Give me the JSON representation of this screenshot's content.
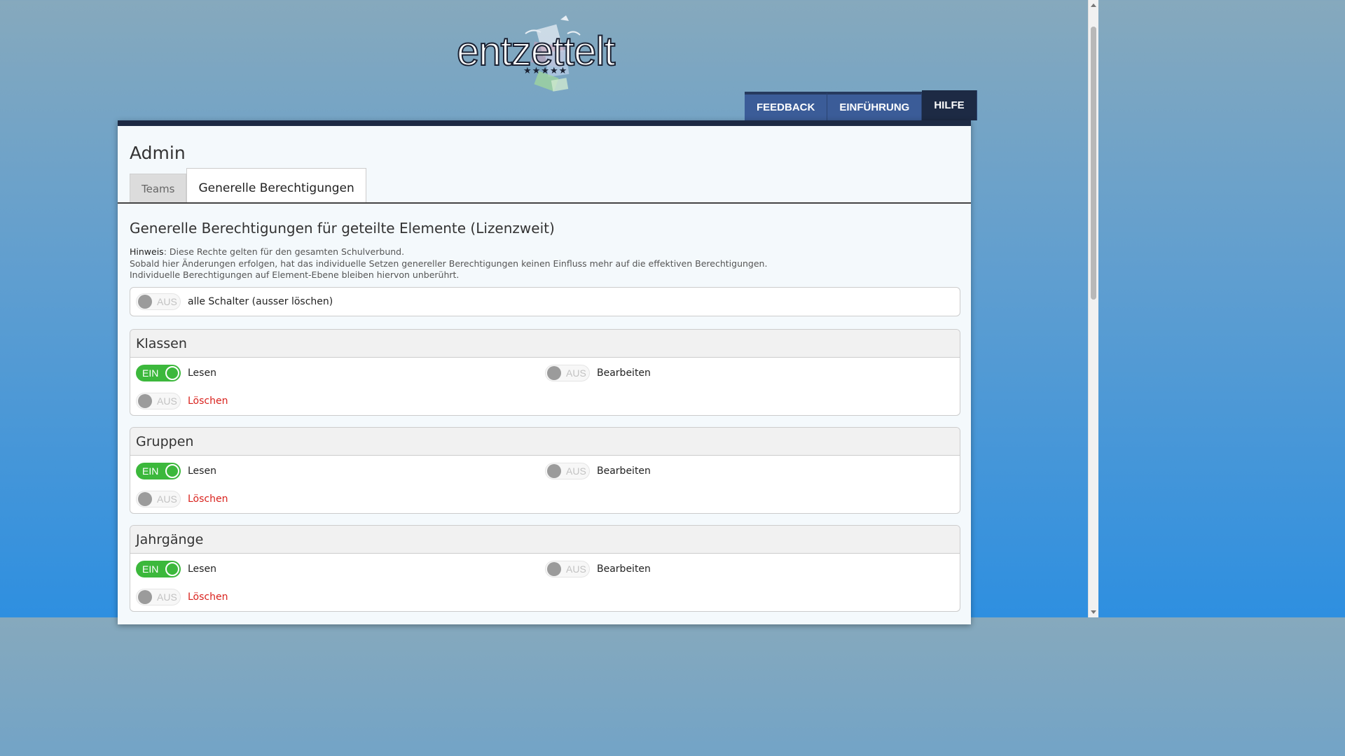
{
  "logo": {
    "text": "entzettelt",
    "stars": "★★★★★"
  },
  "nav": [
    {
      "label": "FEEDBACK",
      "active": false
    },
    {
      "label": "EINFÜHRUNG",
      "active": false
    },
    {
      "label": "HILFE",
      "active": true
    }
  ],
  "page": {
    "title": "Admin",
    "tabs": [
      {
        "label": "Teams",
        "active": false
      },
      {
        "label": "Generelle Berechtigungen",
        "active": true
      }
    ],
    "section_title": "Generelle Berechtigungen für geteilte Elemente (Lizenzweit)",
    "note": {
      "label": "Hinweis",
      "line1": ": Diese Rechte gelten für den gesamten Schulverbund.",
      "line2": "Sobald hier Änderungen erfolgen, hat das individuelle Setzen genereller Berechtigungen keinen Einfluss mehr auf die effektiven Berechtigungen.",
      "line3": "Individuelle Berechtigungen auf Element-Ebene bleiben hiervon unberührt."
    }
  },
  "toggle_text": {
    "on": "EIN",
    "off": "AUS"
  },
  "all_switch": {
    "label": "alle Schalter (ausser löschen)",
    "state": "off"
  },
  "panels": [
    {
      "title": "Klassen",
      "read": {
        "label": "Lesen",
        "state": "on"
      },
      "edit": {
        "label": "Bearbeiten",
        "state": "off"
      },
      "delete": {
        "label": "Löschen",
        "state": "off"
      }
    },
    {
      "title": "Gruppen",
      "read": {
        "label": "Lesen",
        "state": "on"
      },
      "edit": {
        "label": "Bearbeiten",
        "state": "off"
      },
      "delete": {
        "label": "Löschen",
        "state": "off"
      }
    },
    {
      "title": "Jahrgänge",
      "read": {
        "label": "Lesen",
        "state": "on"
      },
      "edit": {
        "label": "Bearbeiten",
        "state": "off"
      },
      "delete": {
        "label": "Löschen",
        "state": "off"
      }
    }
  ],
  "colors": {
    "nav": "#3b5c98",
    "nav_active": "#1d2a44",
    "toggle_on": "#3cb83c",
    "danger": "#d9221d"
  }
}
